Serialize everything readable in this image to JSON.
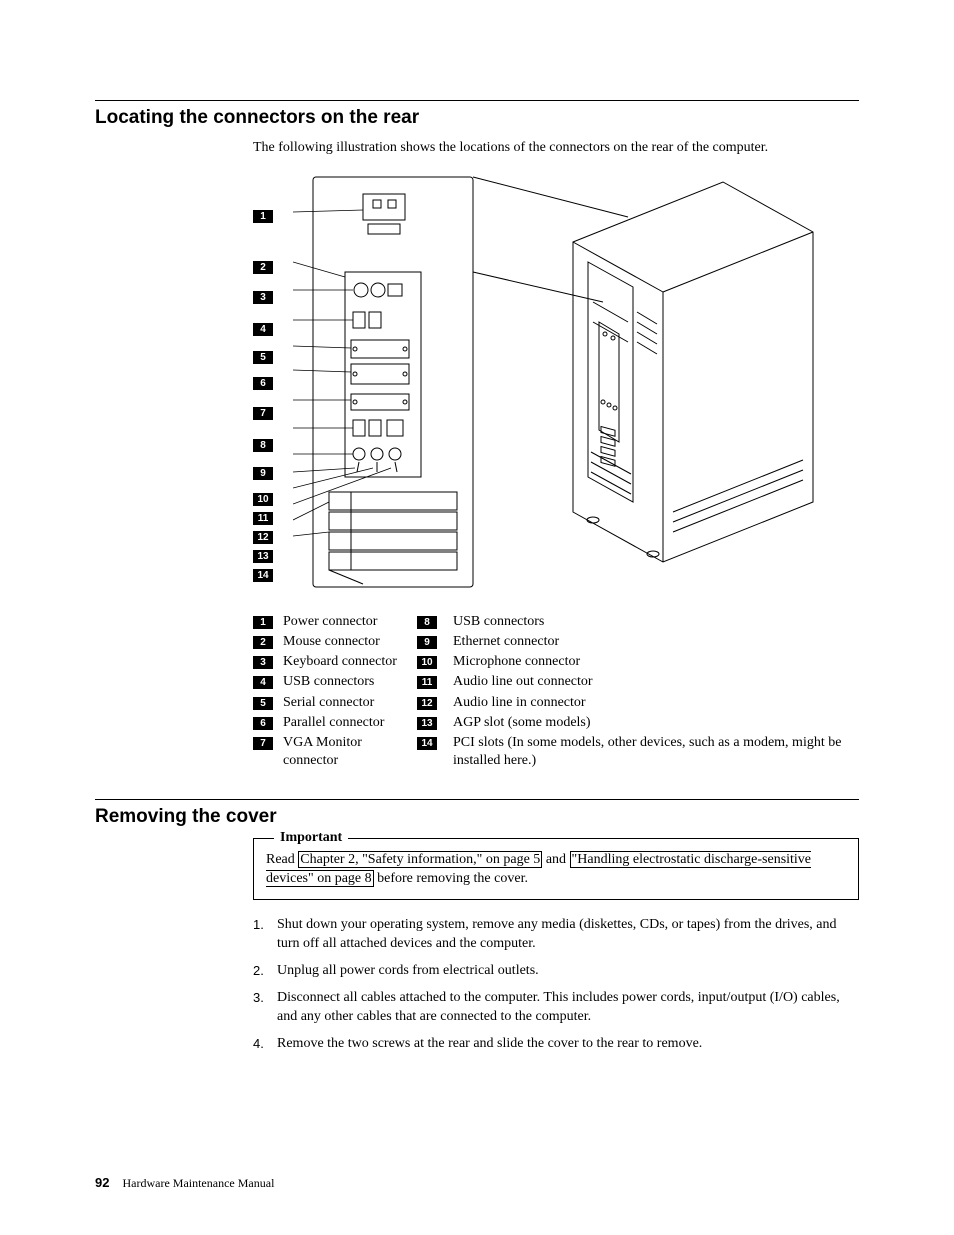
{
  "section1": {
    "heading": "Locating the connectors on the rear",
    "intro": "The following illustration shows the locations of the connectors on the rear of the computer."
  },
  "callouts": [
    "1",
    "2",
    "3",
    "4",
    "5",
    "6",
    "7",
    "8",
    "9",
    "10",
    "11",
    "12",
    "13",
    "14"
  ],
  "legend_rows": [
    {
      "a_num": "1",
      "a_label": "Power connector",
      "b_num": "8",
      "b_label": "USB connectors"
    },
    {
      "a_num": "2",
      "a_label": "Mouse connector",
      "b_num": "9",
      "b_label": "Ethernet connector"
    },
    {
      "a_num": "3",
      "a_label": "Keyboard connector",
      "b_num": "10",
      "b_label": "Microphone connector"
    },
    {
      "a_num": "4",
      "a_label": "USB connectors",
      "b_num": "11",
      "b_label": "Audio line out connector"
    },
    {
      "a_num": "5",
      "a_label": "Serial connector",
      "b_num": "12",
      "b_label": "Audio line in connector"
    },
    {
      "a_num": "6",
      "a_label": "Parallel connector",
      "b_num": "13",
      "b_label": "AGP slot (some models)"
    },
    {
      "a_num": "7",
      "a_label": "VGA Monitor connector",
      "b_num": "14",
      "b_label": "PCI slots (In some models, other devices, such as a modem, might be installed here.)"
    }
  ],
  "section2": {
    "heading": "Removing the cover",
    "important_title": "Important",
    "important_pre": "Read ",
    "important_link1": "Chapter 2, \"Safety information,\" on page 5",
    "important_mid": " and ",
    "important_link2": "\"Handling electrostatic discharge-sensitive devices\" on page 8",
    "important_post": " before removing the cover.",
    "steps": [
      "Shut down your operating system, remove any media (diskettes, CDs, or tapes) from the drives, and turn off all attached devices and the computer.",
      "Unplug all power cords from electrical outlets.",
      "Disconnect all cables attached to the computer. This includes power cords, input/output (I/O) cables, and any other cables that are connected to the computer.",
      "Remove the two screws at the rear and slide the cover to the rear to remove."
    ]
  },
  "footer": {
    "page": "92",
    "book": "Hardware Maintenance Manual"
  }
}
